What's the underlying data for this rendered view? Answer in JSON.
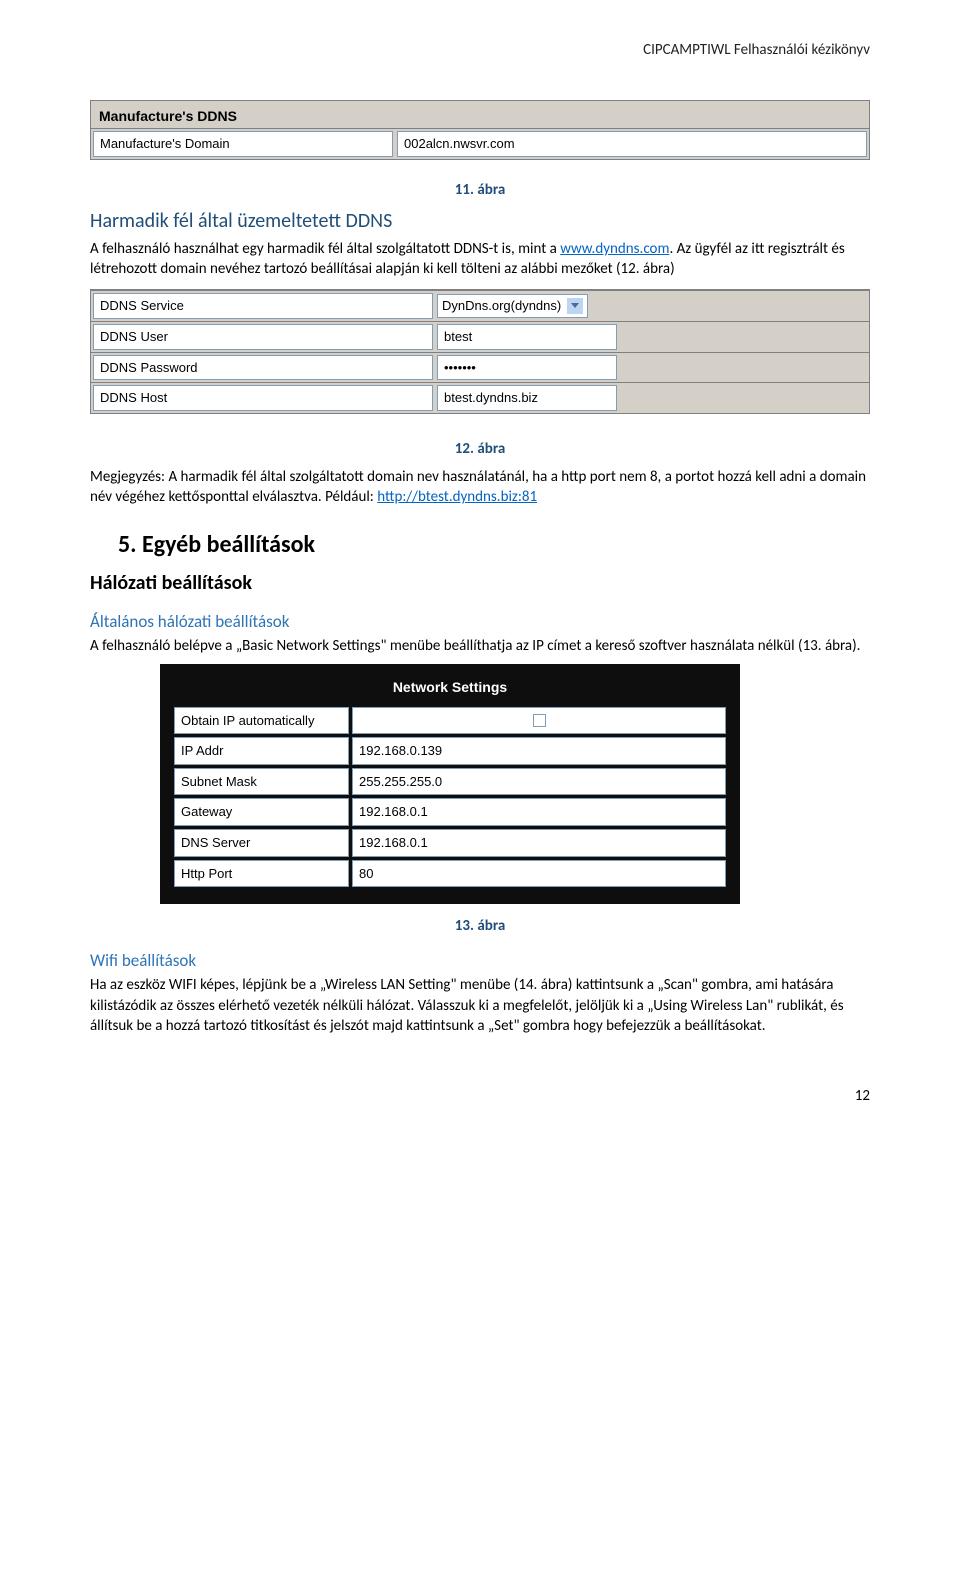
{
  "header": {
    "doc_title": "CIPCAMPTIWL  Felhasználói kézikönyv"
  },
  "ddns_panel": {
    "title": "Manufacture's DDNS",
    "row_label": "Manufacture's Domain",
    "row_value": "002alcn.nwsvr.com"
  },
  "fig11": "11. ábra",
  "section_a": {
    "heading": "Harmadik fél által üzemeltetett DDNS",
    "p1_a": "A felhasználó használhat egy harmadik fél által szolgáltatott DDNS-t is, mint a ",
    "p1_link": "www.dyndns.com",
    "p1_b": ". Az ügyfél az itt regisztrált és létrehozott domain nevéhez tartozó beállításai alapján ki kell tölteni az alábbi mezőket (12. ábra)"
  },
  "ddns_form": {
    "rows": [
      {
        "label": "DDNS Service",
        "value": "DynDns.org(dyndns)",
        "type": "select"
      },
      {
        "label": "DDNS User",
        "value": "btest",
        "type": "text"
      },
      {
        "label": "DDNS Password",
        "value": "•••••••",
        "type": "text"
      },
      {
        "label": "DDNS Host",
        "value": "btest.dyndns.biz",
        "type": "text"
      }
    ]
  },
  "fig12": "12. ábra",
  "note": {
    "a": "Megjegyzés: A harmadik fél által szolgáltatott domain nev használatánál, ha a http port nem 8, a portot hozzá kell adni a domain név végéhez kettősponttal elválasztva. Például: ",
    "link": "http://btest.dyndns.biz:81"
  },
  "section5": {
    "num_title": "5. Egyéb beállítások",
    "sub1": "Hálózati beállítások",
    "sub2": "Általános hálózati beállítások",
    "p": "A felhasználó belépve a „Basic Network Settings\" menübe beállíthatja az IP címet a kereső szoftver használata nélkül (13. ábra)."
  },
  "net": {
    "title": "Network Settings",
    "rows": [
      {
        "label": "Obtain IP automatically",
        "value": "",
        "type": "checkbox"
      },
      {
        "label": "IP Addr",
        "value": "192.168.0.139",
        "type": "text"
      },
      {
        "label": "Subnet Mask",
        "value": "255.255.255.0",
        "type": "text"
      },
      {
        "label": "Gateway",
        "value": "192.168.0.1",
        "type": "text"
      },
      {
        "label": "DNS Server",
        "value": "192.168.0.1",
        "type": "text"
      },
      {
        "label": "Http Port",
        "value": "80",
        "type": "text"
      }
    ]
  },
  "fig13": "13. ábra",
  "wifi": {
    "heading": "Wifi beállítások",
    "p": "Ha az eszköz WIFI képes, lépjünk be a „Wireless LAN Setting\" menübe (14. ábra) kattintsunk a „Scan\" gombra, ami hatására kilistázódik az összes elérhető vezeték nélküli hálózat. Válasszuk ki a megfelelőt, jelöljük ki a „Using Wireless Lan\" rublikát, és állítsuk be a hozzá tartozó titkosítást és jelszót majd kattintsunk a „Set\" gombra hogy befejezzük a beállításokat."
  },
  "page": "12"
}
